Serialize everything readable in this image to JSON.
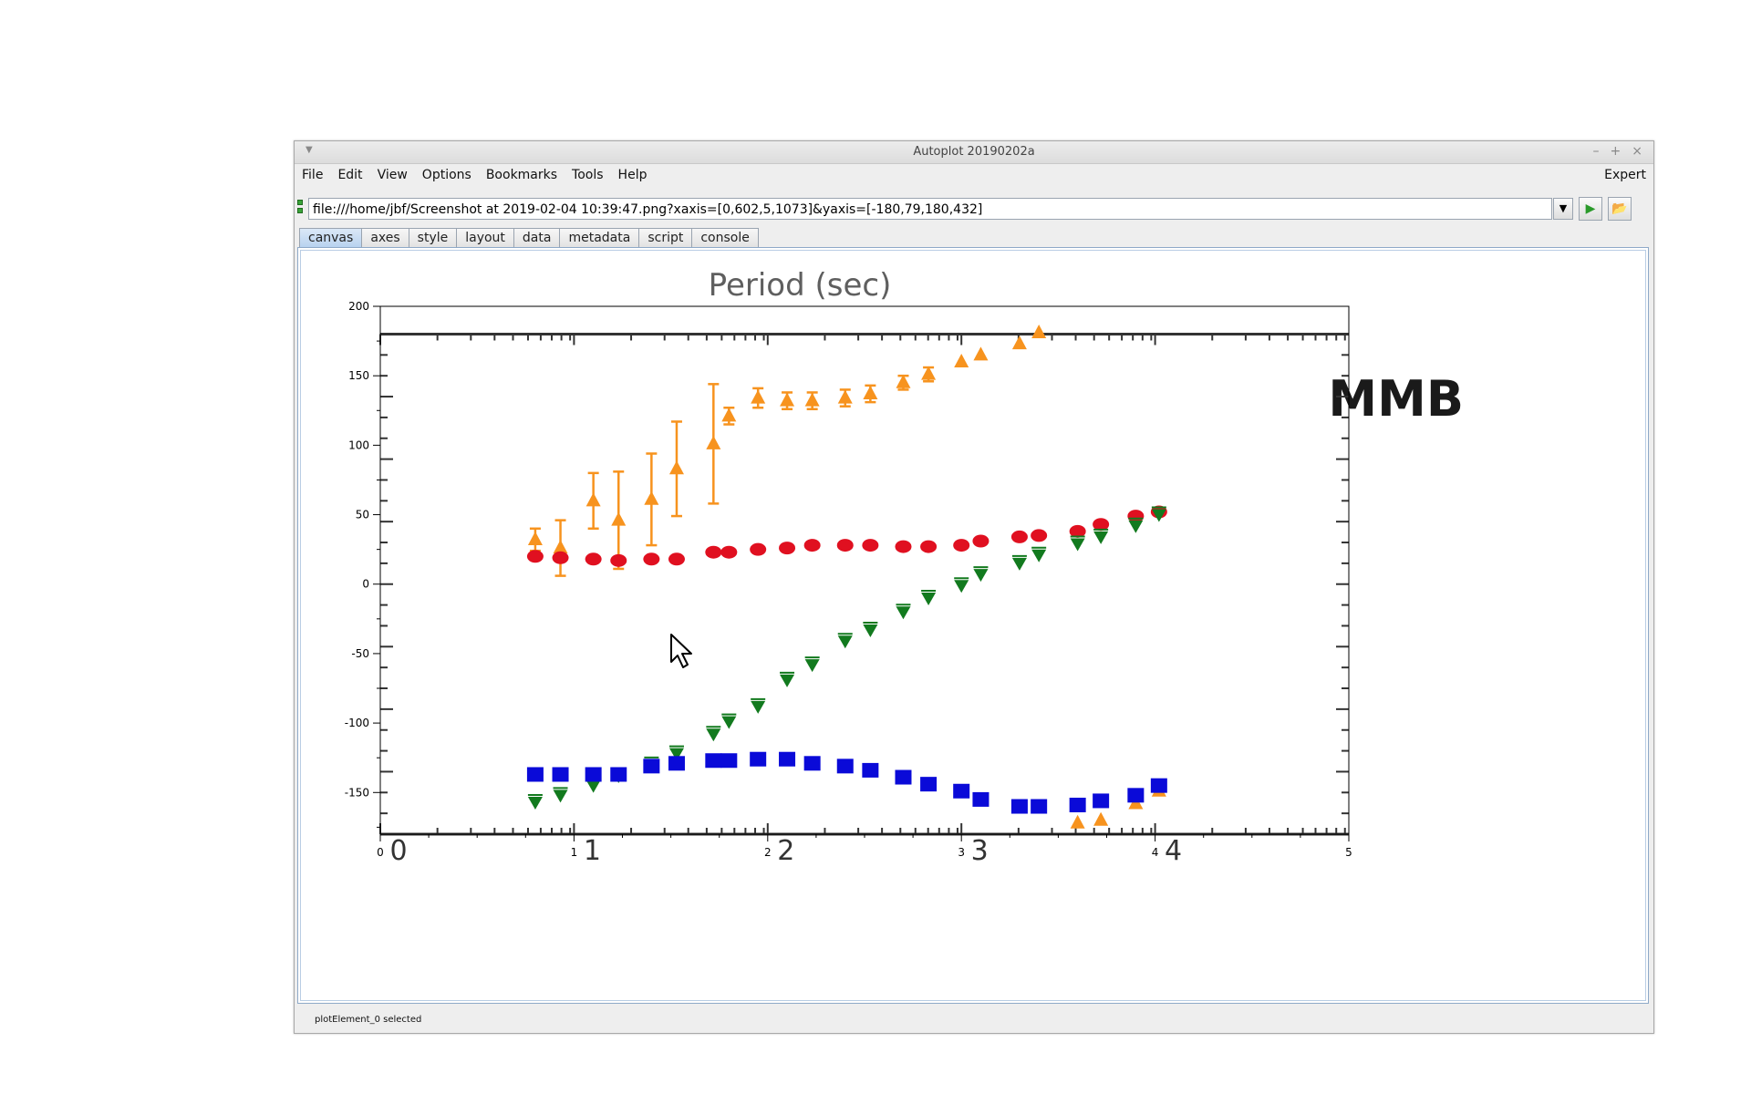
{
  "window": {
    "title": "Autoplot 20190202a",
    "controls": [
      "–",
      "+",
      "×"
    ]
  },
  "menubar": {
    "items": [
      "File",
      "Edit",
      "View",
      "Options",
      "Bookmarks",
      "Tools",
      "Help"
    ],
    "expert": "Expert"
  },
  "url": {
    "value": "file:///home/jbf/Screenshot at 2019-02-04 10:39:47.png?xaxis=[0,602,5,1073]&yaxis=[-180,79,180,432]"
  },
  "tabs": [
    "canvas",
    "axes",
    "style",
    "layout",
    "data",
    "metadata",
    "script",
    "console"
  ],
  "status": {
    "message": "plotElement_0 selected"
  },
  "image": {
    "heading": "Period (sec)",
    "label": "MMB",
    "x_ticks": [
      "0",
      "1",
      "2",
      "3",
      "4"
    ]
  },
  "colors": {
    "orange": "#f7931e",
    "red": "#e01020",
    "green": "#127a1e",
    "blue": "#0a0ad8"
  },
  "chart_data": {
    "type": "scatter",
    "xlim": [
      0,
      5
    ],
    "ylim": [
      -180,
      200
    ],
    "x_ticks": [
      0,
      1,
      2,
      3,
      4,
      5
    ],
    "y_ticks": [
      -150,
      -100,
      -50,
      0,
      50,
      100,
      150,
      200
    ],
    "series": [
      {
        "marker": "triangle-up",
        "color": "#f7931e",
        "points": [
          [
            0.8,
            32
          ],
          [
            0.93,
            26
          ],
          [
            1.1,
            60
          ],
          [
            1.23,
            46
          ],
          [
            1.4,
            61
          ],
          [
            1.53,
            83
          ],
          [
            1.72,
            101
          ],
          [
            1.8,
            121
          ],
          [
            1.95,
            134
          ],
          [
            2.1,
            132
          ],
          [
            2.23,
            132
          ],
          [
            2.4,
            134
          ],
          [
            2.53,
            137
          ],
          [
            2.7,
            145
          ],
          [
            2.83,
            151
          ],
          [
            3.0,
            160
          ],
          [
            3.1,
            165
          ],
          [
            3.3,
            173
          ],
          [
            3.4,
            181
          ],
          [
            3.6,
            -172
          ],
          [
            3.72,
            -170
          ],
          [
            3.9,
            -158
          ],
          [
            4.02,
            -149
          ]
        ],
        "errors": [
          [
            0.8,
            8
          ],
          [
            0.93,
            20
          ],
          [
            1.1,
            20
          ],
          [
            1.23,
            35
          ],
          [
            1.4,
            33
          ],
          [
            1.53,
            34
          ],
          [
            1.72,
            43
          ],
          [
            1.8,
            6
          ],
          [
            1.95,
            7
          ],
          [
            2.1,
            6
          ],
          [
            2.23,
            6
          ],
          [
            2.4,
            6
          ],
          [
            2.53,
            6
          ],
          [
            2.7,
            5
          ],
          [
            2.83,
            5
          ]
        ]
      },
      {
        "marker": "circle",
        "color": "#e01020",
        "points": [
          [
            0.8,
            20
          ],
          [
            0.93,
            19
          ],
          [
            1.1,
            18
          ],
          [
            1.23,
            17
          ],
          [
            1.4,
            18
          ],
          [
            1.53,
            18
          ],
          [
            1.72,
            23
          ],
          [
            1.8,
            23
          ],
          [
            1.95,
            25
          ],
          [
            2.1,
            26
          ],
          [
            2.23,
            28
          ],
          [
            2.4,
            28
          ],
          [
            2.53,
            28
          ],
          [
            2.7,
            27
          ],
          [
            2.83,
            27
          ],
          [
            3.0,
            28
          ],
          [
            3.1,
            31
          ],
          [
            3.3,
            34
          ],
          [
            3.4,
            35
          ],
          [
            3.6,
            38
          ],
          [
            3.72,
            43
          ],
          [
            3.9,
            49
          ],
          [
            4.02,
            52
          ]
        ]
      },
      {
        "marker": "triangle-down",
        "color": "#127a1e",
        "points": [
          [
            0.8,
            -157
          ],
          [
            0.93,
            -152
          ],
          [
            1.1,
            -145
          ],
          [
            1.23,
            -138
          ],
          [
            1.4,
            -130
          ],
          [
            1.53,
            -122
          ],
          [
            1.72,
            -108
          ],
          [
            1.8,
            -99
          ],
          [
            1.95,
            -88
          ],
          [
            2.1,
            -69
          ],
          [
            2.23,
            -58
          ],
          [
            2.4,
            -41
          ],
          [
            2.53,
            -33
          ],
          [
            2.7,
            -20
          ],
          [
            2.83,
            -10
          ],
          [
            3.0,
            -1
          ],
          [
            3.1,
            7
          ],
          [
            3.3,
            15
          ],
          [
            3.4,
            21
          ],
          [
            3.6,
            29
          ],
          [
            3.72,
            34
          ],
          [
            3.9,
            42
          ],
          [
            4.02,
            50
          ]
        ]
      },
      {
        "marker": "square",
        "color": "#0a0ad8",
        "points": [
          [
            0.8,
            -137
          ],
          [
            0.93,
            -137
          ],
          [
            1.1,
            -137
          ],
          [
            1.23,
            -137
          ],
          [
            1.4,
            -131
          ],
          [
            1.53,
            -129
          ],
          [
            1.72,
            -127
          ],
          [
            1.8,
            -127
          ],
          [
            1.95,
            -126
          ],
          [
            2.1,
            -126
          ],
          [
            2.23,
            -129
          ],
          [
            2.4,
            -131
          ],
          [
            2.53,
            -134
          ],
          [
            2.7,
            -139
          ],
          [
            2.83,
            -144
          ],
          [
            3.0,
            -149
          ],
          [
            3.1,
            -155
          ],
          [
            3.3,
            -160
          ],
          [
            3.4,
            -160
          ],
          [
            3.6,
            -159
          ],
          [
            3.72,
            -156
          ],
          [
            3.9,
            -152
          ],
          [
            4.02,
            -145
          ]
        ]
      }
    ]
  }
}
